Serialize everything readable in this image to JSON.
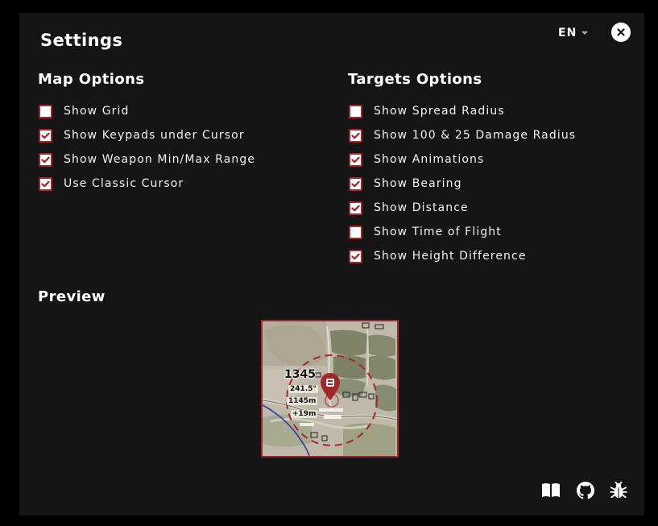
{
  "header": {
    "title": "Settings",
    "language": "EN"
  },
  "map_options": {
    "title": "Map Options",
    "items": [
      {
        "label": "Show Grid",
        "checked": false
      },
      {
        "label": "Show Keypads under Cursor",
        "checked": true
      },
      {
        "label": "Show Weapon Min/Max Range",
        "checked": true
      },
      {
        "label": "Use Classic Cursor",
        "checked": true
      }
    ]
  },
  "targets_options": {
    "title": "Targets Options",
    "items": [
      {
        "label": "Show Spread Radius",
        "checked": false
      },
      {
        "label": "Show 100 & 25 Damage Radius",
        "checked": true
      },
      {
        "label": "Show Animations",
        "checked": true
      },
      {
        "label": "Show Bearing",
        "checked": true
      },
      {
        "label": "Show Distance",
        "checked": true
      },
      {
        "label": "Show Time of Flight",
        "checked": false
      },
      {
        "label": "Show Height Difference",
        "checked": true
      }
    ]
  },
  "preview": {
    "title": "Preview",
    "keypad": "1345",
    "bearing": "241.5°",
    "distance": "1145m",
    "height_diff": "+19m"
  },
  "footer_icons": [
    "book-icon",
    "github-icon",
    "bug-icon"
  ],
  "colors": {
    "accent": "#a3262c",
    "background": "#151515",
    "text": "#ffffff"
  }
}
